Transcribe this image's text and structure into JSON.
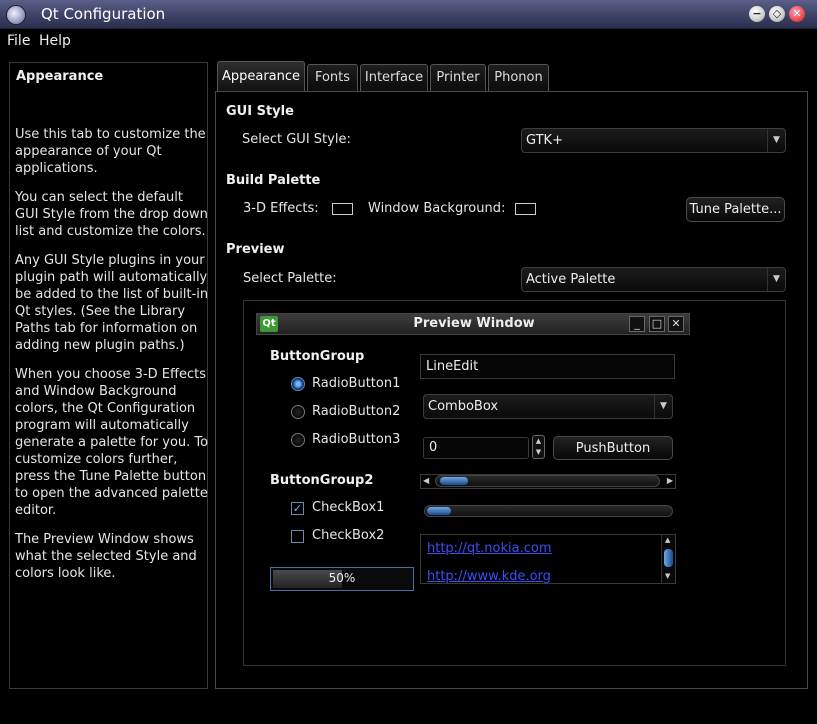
{
  "window": {
    "title": "Qt Configuration",
    "buttons": {
      "minimize": "−",
      "maximize": "◇",
      "close": "✕"
    }
  },
  "menu": [
    {
      "label": "File"
    },
    {
      "label": "Help"
    }
  ],
  "left_panel": {
    "title": "Appearance",
    "paragraphs": [
      "Use this tab to customize the appearance of your Qt applications.",
      "You can select the default GUI Style from the drop down list and customize the colors.",
      "Any GUI Style plugins in your plugin path will automatically be added to the list of built-in Qt styles. (See the Library Paths tab for information on adding new plugin paths.)",
      "When you choose 3-D Effects and Window Background colors, the Qt Configuration program will automatically generate a palette for you. To customize colors further, press the Tune Palette button to open the advanced palette editor.",
      "The Preview Window shows what the selected Style and colors look like."
    ]
  },
  "tabs": [
    {
      "label": "Appearance",
      "active": true
    },
    {
      "label": "Fonts"
    },
    {
      "label": "Interface"
    },
    {
      "label": "Printer"
    },
    {
      "label": "Phonon"
    }
  ],
  "gui_style": {
    "section": "GUI Style",
    "label": "Select GUI Style:",
    "value": "GTK+"
  },
  "build_palette": {
    "section": "Build Palette",
    "effects_label": "3-D Effects:",
    "background_label": "Window Background:",
    "tune_button": "Tune Palette..."
  },
  "preview": {
    "section": "Preview",
    "select_label": "Select Palette:",
    "select_value": "Active Palette",
    "window": {
      "title": "Preview Window",
      "icon_text": "Qt",
      "button_group1": {
        "title": "ButtonGroup",
        "radios": [
          {
            "label": "RadioButton1",
            "checked": true
          },
          {
            "label": "RadioButton2",
            "checked": false
          },
          {
            "label": "RadioButton3",
            "checked": false
          }
        ]
      },
      "button_group2": {
        "title": "ButtonGroup2",
        "checks": [
          {
            "label": "CheckBox1",
            "checked": true
          },
          {
            "label": "CheckBox2",
            "checked": false
          }
        ]
      },
      "progress": {
        "text": "50%",
        "value": 0.5
      },
      "line_edit": "LineEdit",
      "combo_box": "ComboBox",
      "spin_value": "0",
      "push_button": "PushButton",
      "links": [
        "http://qt.nokia.com",
        "http://www.kde.org"
      ]
    }
  },
  "colors": {
    "background": "#000000",
    "accent": "#3b80d6",
    "link": "#3b4ff8",
    "titlebar": "#3b3f63"
  }
}
